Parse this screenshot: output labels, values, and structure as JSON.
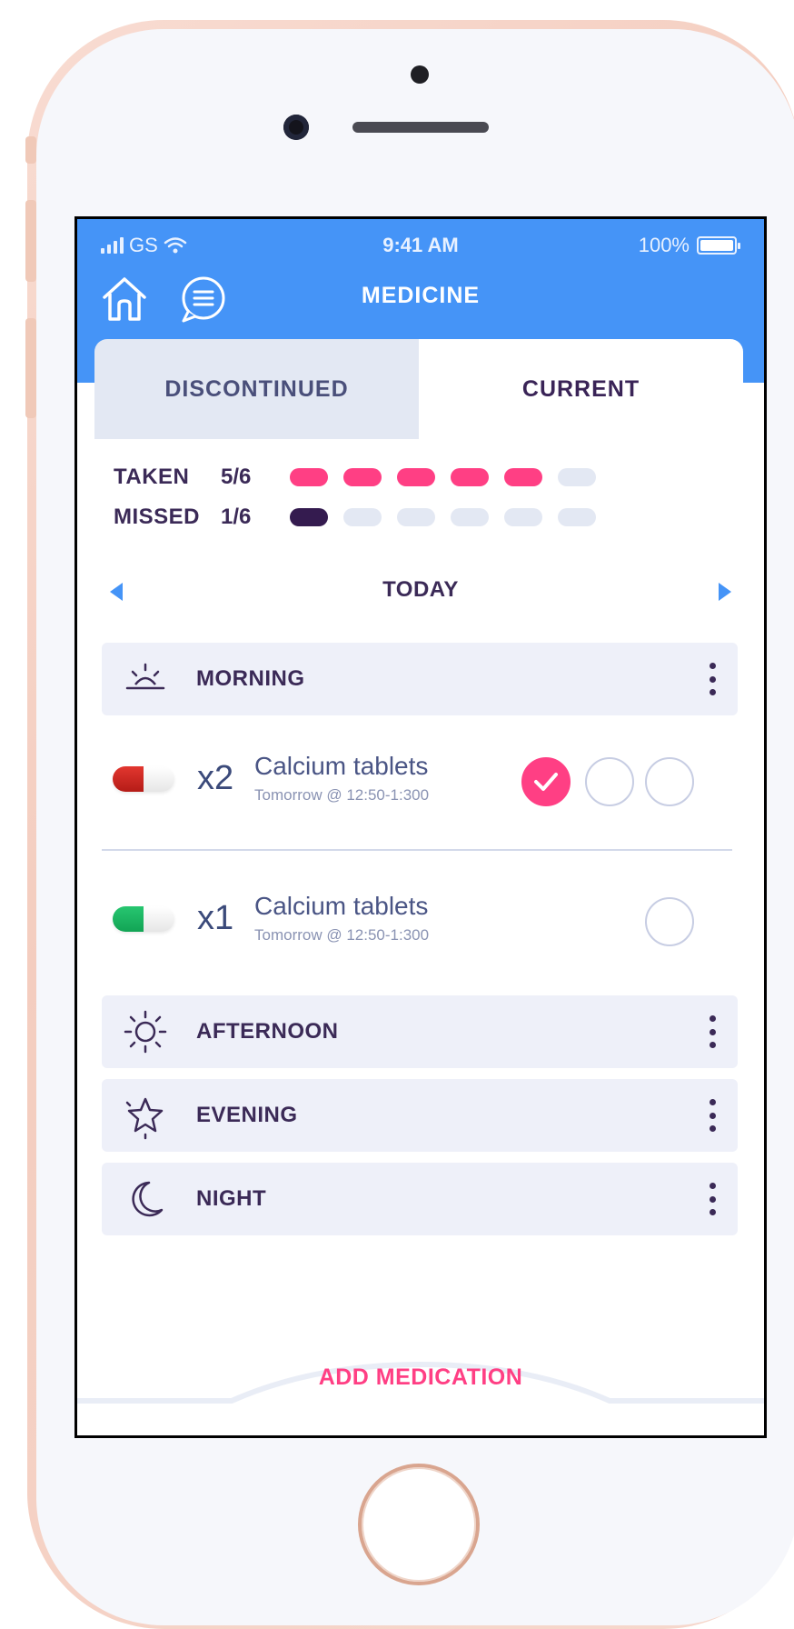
{
  "status_bar": {
    "carrier": "GS",
    "time": "9:41 AM",
    "battery": "100%"
  },
  "header": {
    "title": "MEDICINE",
    "left_icons": [
      "home-icon",
      "chat-icon"
    ]
  },
  "tabs": [
    {
      "label": "DISCONTINUED",
      "selected": false
    },
    {
      "label": "CURRENT",
      "selected": true
    }
  ],
  "stats": {
    "taken": {
      "label": "TAKEN",
      "value": "5/6",
      "count": 5,
      "total": 6,
      "color": "#ff3f84"
    },
    "missed": {
      "label": "MISSED",
      "value": "1/6",
      "count": 1,
      "total": 6,
      "color": "#341b4f"
    }
  },
  "day_nav": {
    "label": "TODAY",
    "prev_icon": "arrow-left-icon",
    "next_icon": "arrow-right-icon"
  },
  "sections": [
    {
      "label": "MORNING",
      "icon": "sunrise-icon",
      "medications": [
        {
          "dose": "x2",
          "name": "Calcium tablets",
          "time": "Tomorrow @ 12:50-1:300",
          "capsule_color": "#d0241f",
          "checks": [
            true,
            false,
            false
          ]
        },
        {
          "dose": "x1",
          "name": "Calcium tablets",
          "time": "Tomorrow @ 12:50-1:300",
          "capsule_color": "#1fb865",
          "checks": [
            false
          ]
        }
      ]
    },
    {
      "label": "AFTERNOON",
      "icon": "sun-icon"
    },
    {
      "label": "EVENING",
      "icon": "star-icon"
    },
    {
      "label": "NIGHT",
      "icon": "moon-icon"
    }
  ],
  "footer": {
    "add_label": "ADD MEDICATION"
  },
  "colors": {
    "header": "#4594f7",
    "accent": "#ff3f84",
    "text_dark": "#3b2a57"
  }
}
